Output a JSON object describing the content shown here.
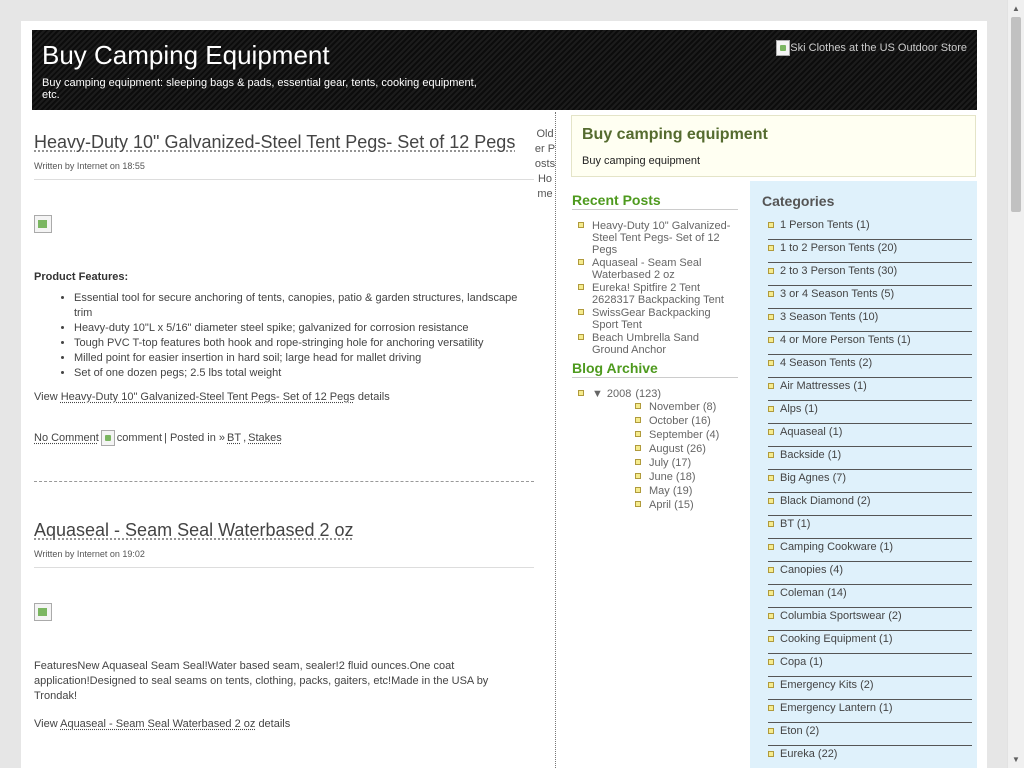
{
  "header": {
    "title": "Buy Camping Equipment",
    "description": "Buy camping equipment: sleeping bags & pads, essential gear, tents, cooking equipment, etc.",
    "ad_alt": "Ski Clothes at the US Outdoor Store"
  },
  "posts": [
    {
      "title": "Heavy-Duty 10\" Galvanized-Steel Tent Pegs- Set of 12 Pegs",
      "meta": "Written by Internet on 18:55",
      "features_title": "Product Features:",
      "features": [
        "Essential tool for secure anchoring of tents, canopies, patio & garden structures, landscape trim",
        "Heavy-duty 10\"L x 5/16\" diameter steel spike; galvanized for corrosion resistance",
        "Tough PVC T-top features both hook and rope-stringing hole for anchoring versatility",
        "Milled point for easier insertion in hard soil; large head for mallet driving",
        "Set of one dozen pegs; 2.5 lbs total weight"
      ],
      "view_prefix": "View",
      "view_link": "Heavy-Duty 10\" Galvanized-Steel Tent Pegs- Set of 12 Pegs",
      "view_suffix": "details",
      "comment_link": "No Comment",
      "comment_img_alt": "comment",
      "posted_in_label": "| Posted in »",
      "tags": [
        "BT",
        "Stakes"
      ]
    },
    {
      "title": "Aquaseal - Seam Seal Waterbased 2 oz",
      "meta": "Written by Internet on 19:02",
      "body": "FeaturesNew Aquaseal Seam Seal!Water based seam, sealer!2 fluid ounces.One coat application!Designed to seal seams on tents, clothing, packs, gaiters, etc!Made in the USA by Trondak!",
      "view_prefix": "View",
      "view_link": "Aquaseal - Seam Seal Waterbased 2 oz",
      "view_suffix": "details"
    }
  ],
  "older_col": {
    "older": "Older Posts",
    "home": "Home"
  },
  "sidebar_box": {
    "title": "Buy camping equipment",
    "text": "Buy camping equipment"
  },
  "recent_posts": {
    "title": "Recent Posts",
    "items": [
      "Heavy-Duty 10\" Galvanized-Steel Tent Pegs- Set of 12 Pegs",
      "Aquaseal - Seam Seal Waterbased 2 oz",
      "Eureka! Spitfire 2 Tent 2628317 Backpacking Tent",
      "SwissGear Backpacking Sport Tent",
      "Beach Umbrella Sand Ground Anchor"
    ]
  },
  "blog_archive": {
    "title": "Blog Archive",
    "toggle": "▼",
    "year": "2008",
    "year_count": "(123)",
    "months": [
      {
        "name": "November",
        "count": "(8)"
      },
      {
        "name": "October",
        "count": "(16)"
      },
      {
        "name": "September",
        "count": "(4)"
      },
      {
        "name": "August",
        "count": "(26)"
      },
      {
        "name": "July",
        "count": "(17)"
      },
      {
        "name": "June",
        "count": "(18)"
      },
      {
        "name": "May",
        "count": "(19)"
      },
      {
        "name": "April",
        "count": "(15)"
      }
    ]
  },
  "categories": {
    "title": "Categories",
    "items": [
      "1 Person Tents (1)",
      "1 to 2 Person Tents (20)",
      "2 to 3 Person Tents (30)",
      "3 or 4 Season Tents (5)",
      "3 Season Tents (10)",
      "4 or More Person Tents (1)",
      "4 Season Tents (2)",
      "Air Mattresses (1)",
      "Alps (1)",
      "Aquaseal (1)",
      "Backside (1)",
      "Big Agnes (7)",
      "Black Diamond (2)",
      "BT (1)",
      "Camping Cookware (1)",
      "Canopies (4)",
      "Coleman (14)",
      "Columbia Sportswear (2)",
      "Cooking Equipment (1)",
      "Copa (1)",
      "Emergency Kits (2)",
      "Emergency Lantern (1)",
      "Eton (2)",
      "Eureka (22)"
    ]
  },
  "scrollbar": {
    "up": "▲",
    "down": "▼"
  }
}
